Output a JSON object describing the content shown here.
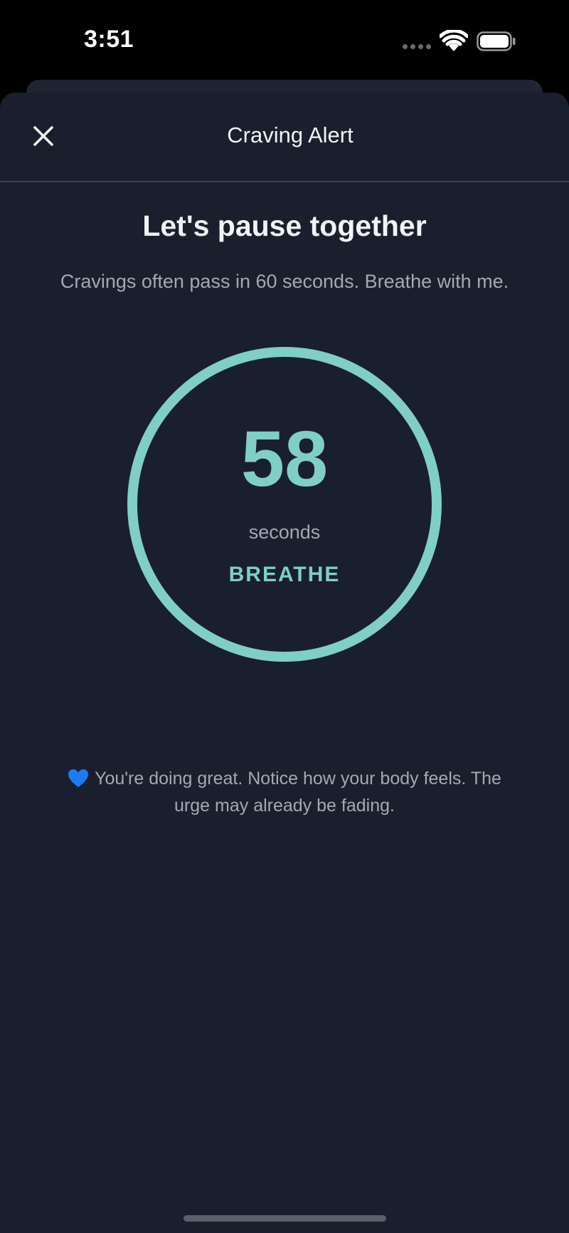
{
  "status_bar": {
    "time": "3:51"
  },
  "header": {
    "title": "Craving Alert",
    "close_icon": "close-icon"
  },
  "main": {
    "headline": "Let's pause together",
    "subtitle": "Cravings often pass in 60 seconds. Breathe with me.",
    "timer": {
      "value": "58",
      "unit": "seconds",
      "phase": "BREATHE",
      "progress": 1.0
    },
    "encouragement": {
      "icon": "blue-heart-icon",
      "text": "You're doing great. Notice how your body feels. The urge may already be fading."
    }
  },
  "colors": {
    "background": "#1a1f2d",
    "accent": "#7fcfc4",
    "text_primary": "#f2f3f5",
    "text_secondary": "#a4a8b4",
    "heart": "#1a7cf5"
  }
}
